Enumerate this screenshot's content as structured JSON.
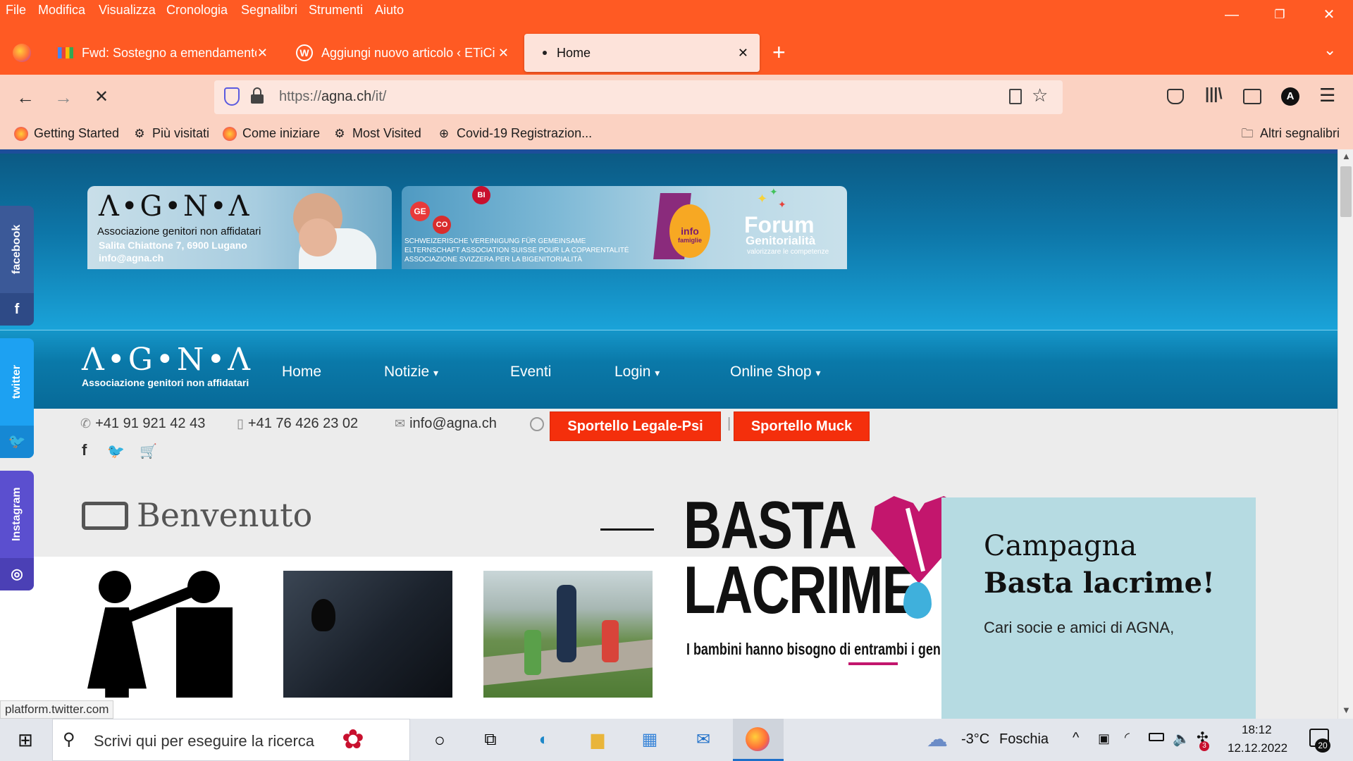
{
  "browser": {
    "menu": [
      "File",
      "Modifica",
      "Visualizza",
      "Cronologia",
      "Segnalibri",
      "Strumenti",
      "Aiuto"
    ],
    "tabs": [
      {
        "label": "Fwd: Sostegno a emendamento"
      },
      {
        "label": "Aggiungi nuovo articolo ‹ ETiCi"
      },
      {
        "label": "Home"
      }
    ],
    "url_prefix": "https://",
    "url_host": "agna.ch",
    "url_path": "/it/",
    "bookmarks": [
      "Getting Started",
      "Più visitati",
      "Come iniziare",
      "Most Visited",
      "Covid-19 Registrazion..."
    ],
    "other_bookmarks": "Altri segnalibri",
    "profile_letter": "A",
    "status_url": "platform.twitter.com"
  },
  "site": {
    "banner": {
      "logo": "Λ•G•N•Λ",
      "org": "Associazione genitori non affidatari",
      "address": "Salita Chiattone 7, 6900 Lugano",
      "email": "info@agna.ch",
      "gebi_1": "SCHWEIZERISCHE VEREINIGUNG FÜR GEMEINSAME",
      "gebi_2": "ELTERNSCHAFT ASSOCIATION SUISSE POUR LA COPARENTALITÉ",
      "gebi_3": "ASSOCIAZIONE SVIZZERA PER LA BIGENITORIALITÀ",
      "forum_1": "Forum",
      "forum_2": "Genitorialità",
      "forum_3": "valorizzare le competenze",
      "info_1": "info",
      "info_2": "famiglie"
    },
    "nav_logo": "Λ•G•N•Λ",
    "nav_org": "Associazione genitori non affidatari",
    "nav": [
      "Home",
      "Notizie",
      "Eventi",
      "Login",
      "Online Shop"
    ],
    "phone1": "+41 91 921 42 43",
    "phone2": "+41 76 426 23 02",
    "email": "info@agna.ch",
    "btn_legale": "Sportello Legale-Psi",
    "btn_muck": "Sportello Muck",
    "welcome": "Benvenuto",
    "basta_1": "BASTA",
    "basta_2": "LACRIME",
    "basta_tag": "I bambini hanno bisogno di entrambi i genitori !",
    "promo_1": "Campagna",
    "promo_2": "Basta lacrime!",
    "promo_text": "Cari socie e amici di AGNA,",
    "social": [
      "facebook",
      "twitter",
      "Instagram"
    ]
  },
  "taskbar": {
    "search_placeholder": "Scrivi qui per eseguire la ricerca",
    "temp": "-3°C",
    "weather": "Foschia",
    "time": "18:12",
    "date": "12.12.2022",
    "notif_count": "20",
    "mail_badge": "3"
  },
  "colors": {
    "firefox_orange": "#ff5a23",
    "nav_blue": "#0a79a9",
    "red_button": "#f42f0c"
  }
}
